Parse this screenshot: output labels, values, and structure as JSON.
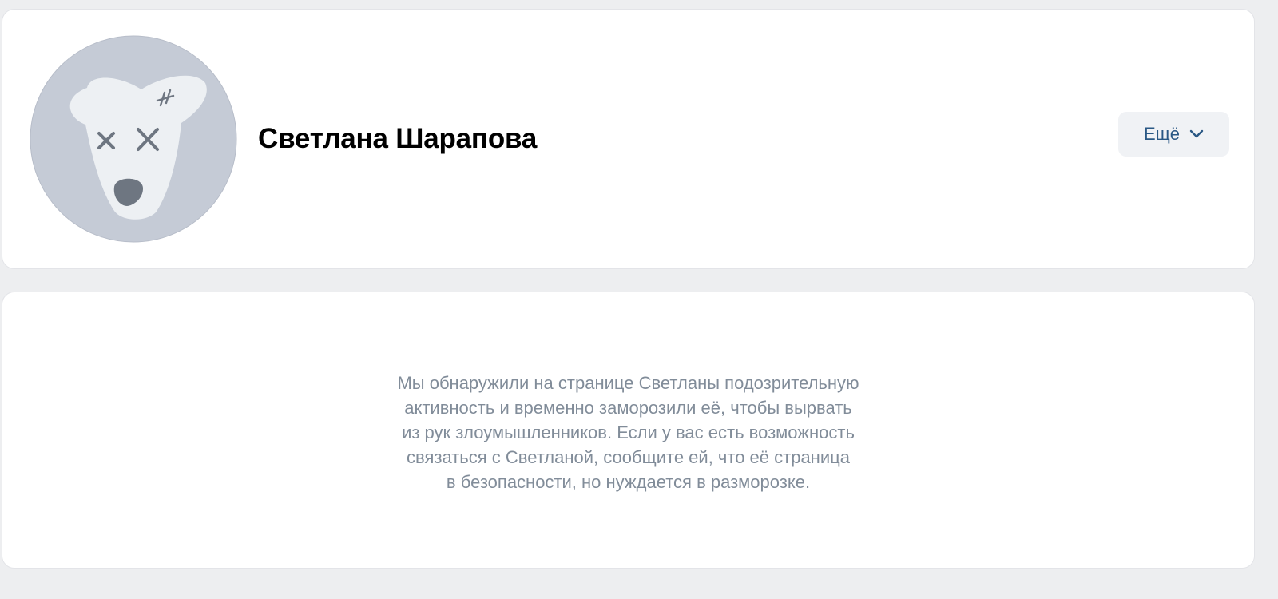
{
  "profile": {
    "name": "Светлана Шарапова",
    "avatar_icon": "frozen-dog-avatar-icon",
    "more_button": {
      "label": "Ещё",
      "icon": "chevron-down-icon"
    }
  },
  "notice": {
    "lines": [
      "Мы обнаружили на странице Светланы подозрительную",
      "активность и временно заморозили её, чтобы вырвать",
      "из рук злоумышленников. Если у вас есть возможность",
      "связаться с Светланой, сообщите ей, что её страница",
      "в безопасности, но нуждается в разморозке."
    ]
  },
  "colors": {
    "background": "#edeef0",
    "card": "#ffffff",
    "accent_text": "#2a5885",
    "muted_text": "#818c99",
    "avatar_bg": "#c5cbd6",
    "avatar_face": "#edf0f3",
    "avatar_marks": "#6e7681"
  }
}
